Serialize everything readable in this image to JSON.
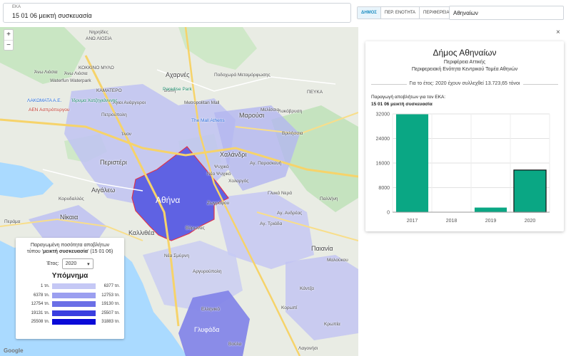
{
  "topbar": {
    "eka_label": "ΕΚΑ",
    "eka_value": "15 01 06 μεικτή συσκευασία",
    "tabs": [
      {
        "label": "ΔΗΜΟΣ",
        "active": true
      },
      {
        "label": "ΠΕΡ. ΕΝΟΤΗΤΑ",
        "active": false
      },
      {
        "label": "ΠΕΡΙΦΕΡΕΙΑ",
        "active": false
      }
    ],
    "search_value": "Αθηναίων"
  },
  "map": {
    "zoom_in": "+",
    "zoom_out": "−",
    "google": "Google",
    "labels": [
      "Nηρηίδες",
      "ΑΝΩ ΛΙΟΣΙΑ",
      "ΚΟΚΚΙΝΟ ΜΥΛΟ",
      "ΚΑΜΑΤΕΡΟ",
      "ΠΕΥΚΑ",
      "Άγιοι Ανάργυροι",
      "Βοΐνη",
      "Αχαρνές",
      "Ίλιον",
      "Λυκόβρυση",
      "Ποδοχωρά Μεταμόρφωσης",
      "Άνω Λιόσια",
      "Waterfun Waterpark",
      "Ίδρυμα Χατζηγιάνννης",
      "Άνω Λιόσια",
      "Paradise Park",
      "Metropolitan Mall",
      "ΛΑΚΩΜΑΤΑ Α.Ε.",
      "Πετρούπολη",
      "Μαρούσι",
      "Μελίσσια",
      "AEN Ασπρόπυργου",
      "The Mall Athens",
      "Βριλήσσια",
      "Περιστέρι",
      "Χαλάνδρι",
      "Ψυχικό",
      "Νέο Ψυχικό",
      "Χολαργός",
      "Αιγάλεω",
      "Αθήνα",
      "Βύρωνας",
      "Ζωγράφου",
      "Καλλιθέα",
      "Νέα Σμύρνη",
      "Γλυκά Νερά",
      "Νίκαια",
      "Κορυδαλλός",
      "Περάμα",
      "Παλλήνη",
      "Αγ. Παρασκευή",
      "Αγ. Ανδρέας",
      "Αγ. Τριάδα",
      "Αργυρούπολη",
      "Ελληνικό",
      "Βούλα",
      "Κάντζα",
      "Κορωπί",
      "Γλυφάδα",
      "Μαλούκου",
      "Παιανία",
      "Κρωπία",
      "Λαγονήσι"
    ]
  },
  "legend": {
    "title_line1": "Παραγωμένη ποσότητα αποβλήτων",
    "title_line2_prefix": "τύπου '",
    "title_line2_bold": "μεικτή συσκευασία",
    "title_line2_suffix": "' (15 01 06)",
    "year_label": "Έτος:",
    "year_value": "2020",
    "heading": "Υπόμνημα",
    "rows": [
      {
        "lo": "1 τn.",
        "hi": "6377 τn.",
        "color": "#c5c8f5"
      },
      {
        "lo": "6378 τn.",
        "hi": "12753 τn.",
        "color": "#9b9ff0"
      },
      {
        "lo": "12754 τn.",
        "hi": "19130 τn.",
        "color": "#6b6fe6"
      },
      {
        "lo": "19131 τn.",
        "hi": "25507 τn.",
        "color": "#3a3ee0"
      },
      {
        "lo": "25508 τn.",
        "hi": "31883 τn.",
        "color": "#0a0ad8"
      }
    ]
  },
  "panel": {
    "close": "×",
    "title": "Δήμος Αθηναίων",
    "subtitle1": "Περιφέρεια Αττικής",
    "subtitle2": "Περιφερειακή Ενότητα Κεντρικού Τομέα Αθηνών",
    "note": "Για το έτος: 2020 έχουν συλλεχθεί 13.723,65 τόνοι",
    "chart_title1": "Παραγωγή αποβλήτων για τον ΕΚΑ:",
    "chart_title2": "15 01 06 μεικτή συσκευασία"
  },
  "chart_data": {
    "type": "bar",
    "categories": [
      "2017",
      "2018",
      "2019",
      "2020"
    ],
    "values": [
      31883,
      0,
      1500,
      13724
    ],
    "ylim": [
      0,
      32000
    ],
    "yticks": [
      0,
      8000,
      16000,
      24000,
      32000
    ],
    "bar_color": "#0aa784",
    "highlight_category": "2020",
    "grid": true
  }
}
